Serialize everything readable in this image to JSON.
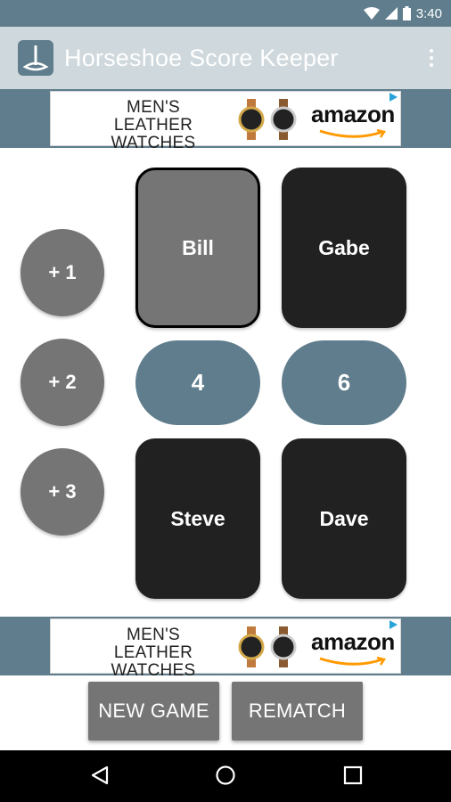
{
  "status_bar": {
    "time": "3:40",
    "icons": [
      "wifi-icon",
      "signal-icon",
      "battery-icon"
    ]
  },
  "app_bar": {
    "title": "Horseshoe Score Keeper",
    "icon": "horseshoe-app-icon",
    "menu_icon": "overflow-menu-icon"
  },
  "ads": {
    "top": {
      "headline_line1": "MEN'S LEATHER",
      "headline_line2": "WATCHES",
      "brand": "amazon"
    },
    "bottom": {
      "headline_line1": "MEN'S LEATHER",
      "headline_line2": "WATCHES",
      "brand": "amazon"
    }
  },
  "increment_buttons": [
    "+ 1",
    "+ 2",
    "+ 3"
  ],
  "players": {
    "top_left": {
      "name": "Bill",
      "selected": true
    },
    "top_right": {
      "name": "Gabe",
      "selected": false
    },
    "bottom_left": {
      "name": "Steve",
      "selected": false
    },
    "bottom_right": {
      "name": "Dave",
      "selected": false
    }
  },
  "scores": {
    "team_left": "4",
    "team_right": "6"
  },
  "actions": {
    "new_game": "NEW GAME",
    "rematch": "REMATCH"
  },
  "nav_bar": [
    "back-icon",
    "home-icon",
    "recents-icon"
  ],
  "colors": {
    "accent": "#5f7d8c",
    "app_bar": "#cfd8dc",
    "card_dark": "#212121",
    "card_selected": "#757575",
    "button_gray": "#757575"
  }
}
